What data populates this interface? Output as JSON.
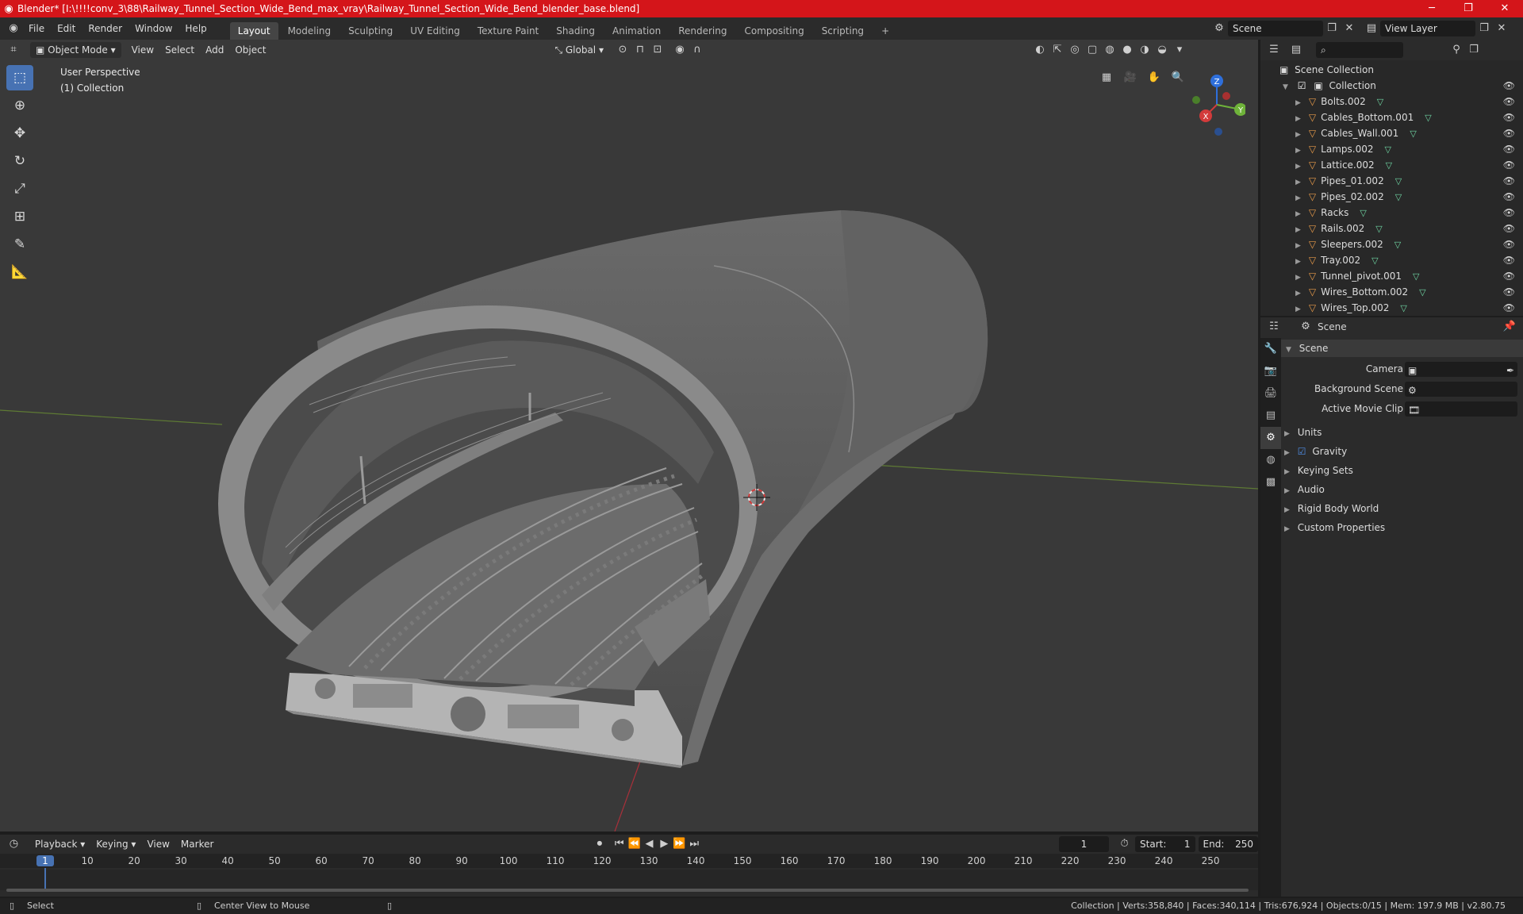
{
  "window": {
    "title": "Blender* [I:\\!!!!conv_3\\88\\Railway_Tunnel_Section_Wide_Bend_max_vray\\Railway_Tunnel_Section_Wide_Bend_blender_base.blend]",
    "minimize": "─",
    "maximize": "❐",
    "close": "✕"
  },
  "menubar": {
    "menus": [
      "File",
      "Edit",
      "Render",
      "Window",
      "Help"
    ],
    "workspaces": [
      "Layout",
      "Modeling",
      "Sculpting",
      "UV Editing",
      "Texture Paint",
      "Shading",
      "Animation",
      "Rendering",
      "Compositing",
      "Scripting"
    ],
    "add_workspace": "+",
    "scene_label": "Scene",
    "view_layer_label": "View Layer"
  },
  "viewport": {
    "mode": "Object Mode",
    "menus": [
      "View",
      "Select",
      "Add",
      "Object"
    ],
    "transform_orientation": "Global",
    "info_line1": "User Perspective",
    "info_line2": "(1) Collection",
    "gizmo": {
      "z": "Z",
      "y": "Y",
      "x": "X"
    }
  },
  "outliner": {
    "root": "Scene Collection",
    "collection": "Collection",
    "objects": [
      "Bolts.002",
      "Cables_Bottom.001",
      "Cables_Wall.001",
      "Lamps.002",
      "Lattice.002",
      "Pipes_01.002",
      "Pipes_02.002",
      "Racks",
      "Rails.002",
      "Sleepers.002",
      "Tray.002",
      "Tunnel_pivot.001",
      "Wires_Bottom.002",
      "Wires_Top.002"
    ]
  },
  "properties": {
    "header": "Scene",
    "panel_title": "Scene",
    "fields": [
      {
        "label": "Camera"
      },
      {
        "label": "Background Scene"
      },
      {
        "label": "Active Movie Clip"
      }
    ],
    "sections": [
      "Units",
      "Gravity",
      "Keying Sets",
      "Audio",
      "Rigid Body World",
      "Custom Properties"
    ]
  },
  "timeline": {
    "menus": [
      "Playback",
      "Keying",
      "View",
      "Marker"
    ],
    "current_frame": "1",
    "start_label": "Start:",
    "start_value": "1",
    "end_label": "End:",
    "end_value": "250",
    "ticks": [
      "1",
      "10",
      "20",
      "30",
      "40",
      "50",
      "60",
      "70",
      "80",
      "90",
      "100",
      "110",
      "120",
      "130",
      "140",
      "150",
      "160",
      "170",
      "180",
      "190",
      "200",
      "210",
      "220",
      "230",
      "240",
      "250"
    ]
  },
  "statusbar": {
    "left_action": "Select",
    "middle_action": "Center View to Mouse",
    "stats": "Collection | Verts:358,840 | Faces:340,114 | Tris:676,924 | Objects:0/15 | Mem: 197.9 MB | v2.80.75"
  }
}
